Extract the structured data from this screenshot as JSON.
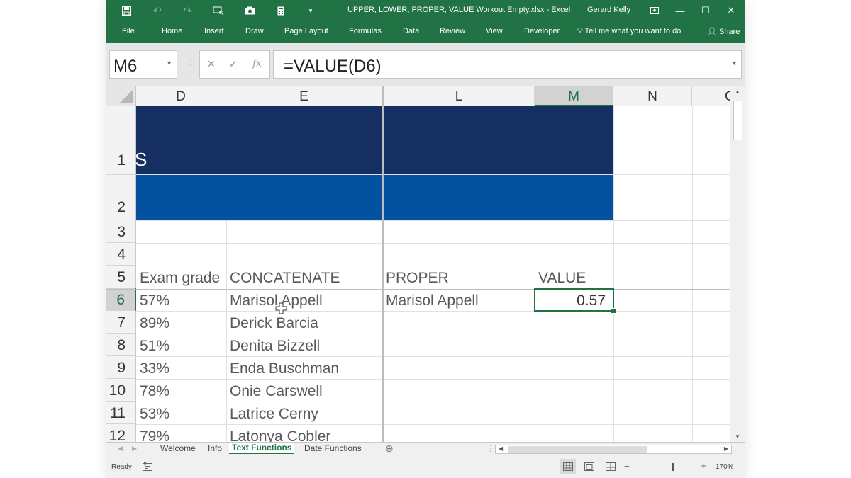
{
  "window": {
    "title": "UPPER, LOWER, PROPER, VALUE Workout Empty.xlsx  -  Excel",
    "user": "Gerard Kelly",
    "accent_color": "#217346",
    "icons": [
      "save-icon",
      "undo-icon",
      "redo-icon",
      "insert-shape-icon",
      "camera-icon",
      "calculator-icon",
      "customize-qat-icon"
    ]
  },
  "ribbon": {
    "tabs": [
      "File",
      "Home",
      "Insert",
      "Draw",
      "Page Layout",
      "Formulas",
      "Data",
      "Review",
      "View",
      "Developer"
    ],
    "tell_me": "Tell me what you want to do",
    "share": "Share"
  },
  "formula_bar": {
    "name_box": "M6",
    "formula": "=VALUE(D6)"
  },
  "sheet": {
    "columns": [
      "D",
      "E",
      "L",
      "M",
      "N",
      "C"
    ],
    "selected_column": "M",
    "rows": [
      "1",
      "2",
      "3",
      "4",
      "5",
      "6",
      "7",
      "8",
      "9",
      "10",
      "11",
      "12"
    ],
    "selected_row": "6",
    "row1_text": "S",
    "band_colors": [
      "#162f62",
      "#0451a0"
    ],
    "headers": {
      "d": "Exam grade",
      "e": "CONCATENATE",
      "l": "PROPER",
      "m": "VALUE"
    },
    "data_rows": [
      {
        "d": "57%",
        "e": "Marisol Appell",
        "l": "Marisol Appell",
        "m": "0.57"
      },
      {
        "d": "89%",
        "e": "Derick Barcia",
        "l": "",
        "m": ""
      },
      {
        "d": "51%",
        "e": "Denita Bizzell",
        "l": "",
        "m": ""
      },
      {
        "d": "33%",
        "e": "Enda Buschman",
        "l": "",
        "m": ""
      },
      {
        "d": "78%",
        "e": "Onie Carswell",
        "l": "",
        "m": ""
      },
      {
        "d": "53%",
        "e": "Latrice Cerny",
        "l": "",
        "m": ""
      },
      {
        "d": "79%",
        "e": "Latonya Cobler",
        "l": "",
        "m": ""
      }
    ]
  },
  "sheet_tabs": [
    "Welcome",
    "Info",
    "Text Functions",
    "Date Functions"
  ],
  "active_sheet": "Text Functions",
  "status": {
    "ready": "Ready",
    "zoom": "170%"
  }
}
